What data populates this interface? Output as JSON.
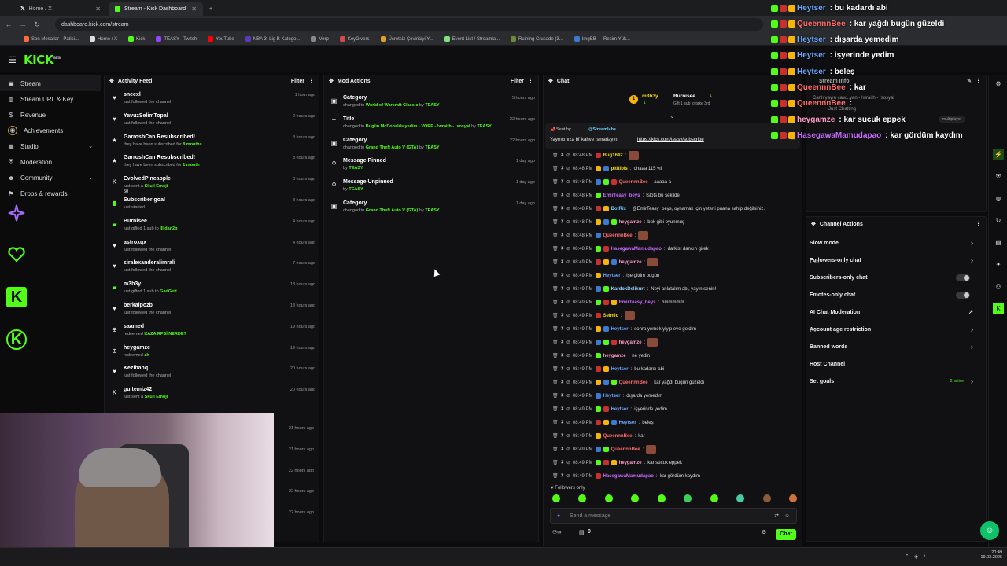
{
  "browser": {
    "tabs": [
      {
        "label": "Home / X"
      },
      {
        "label": "Stream - Kick Dashboard"
      }
    ],
    "new_tab": "+",
    "url": "dashboard.kick.com/stream",
    "bookmarks": [
      "Son Mesajlar - Patici...",
      "Home / X",
      "Kick",
      "TEASY - Twitch",
      "YouTube",
      "NBA 3. Lig B Katego...",
      "Vorp",
      "KeyGivers",
      "Ücretsiz Çeviriciyi Y...",
      "Event List / Streamla...",
      "Ruining Crusade (3...",
      "ImgBB — Resim Yük..."
    ],
    "all_bookmarks": "Tüm Yer İşaretleri"
  },
  "brand": {
    "logo": "KICK",
    "beta": "BETA",
    "accent": "#53fc18"
  },
  "sidebar": {
    "items": [
      {
        "label": "Stream",
        "icon": "video-icon"
      },
      {
        "label": "Stream URL & Key",
        "icon": "globe-icon"
      },
      {
        "label": "Revenue",
        "icon": "dollar-icon"
      },
      {
        "label": "Achievements",
        "icon": "trophy-icon"
      },
      {
        "label": "Studio",
        "icon": "grid-icon"
      },
      {
        "label": "Moderation",
        "icon": "shield-icon"
      },
      {
        "label": "Community",
        "icon": "people-icon"
      },
      {
        "label": "Drops & rewards",
        "icon": "gift-icon"
      }
    ]
  },
  "activity_feed": {
    "title": "Activity Feed",
    "filter": "Filter",
    "items": [
      {
        "name": "sneexl",
        "sub": "just followed the channel",
        "time": "1 hour ago",
        "icon": "heart-icon"
      },
      {
        "name": "YavuzSelimTopal",
        "sub": "just followed the channel",
        "time": "2 hours ago",
        "icon": "heart-icon"
      },
      {
        "name": "GarroshCan Resubscribed!",
        "sub_pre": "they have been subscribed for",
        "sub_hl": "8 months",
        "time": "3 hours ago",
        "icon": "star-icon"
      },
      {
        "name": "GarroshCan Resubscribed!",
        "sub_pre": "they have been subscribed for",
        "sub_hl": "1 month",
        "time": "3 hours ago",
        "icon": "star-icon"
      },
      {
        "name": "EvolvedPineapple",
        "sub_pre": "just sent a",
        "sub_hl": "Skull Emoji",
        "extra": "50",
        "time": "3 hours ago",
        "icon": "kick-icon"
      },
      {
        "name": "Subscriber goal",
        "sub": "just started",
        "time": "3 hours ago",
        "icon": "goal-icon"
      },
      {
        "name": "Burnisee",
        "sub_pre": "just gifted 1 sub to",
        "sub_hl": "Illidan2g",
        "time": "4 hours ago",
        "icon": "gift-icon"
      },
      {
        "name": "astroxqx",
        "sub": "just followed the channel",
        "time": "4 hours ago",
        "icon": "heart-icon"
      },
      {
        "name": "siralexanderalimrali",
        "sub": "just followed the channel",
        "time": "7 hours ago",
        "icon": "heart-icon"
      },
      {
        "name": "m3b3y",
        "sub_pre": "just gifted 1 sub to",
        "sub_hl": "GadGett",
        "time": "18 hours ago",
        "icon": "gift-icon"
      },
      {
        "name": "berkalpozb",
        "sub": "just followed the channel",
        "time": "18 hours ago",
        "icon": "heart-icon"
      },
      {
        "name": "saamed",
        "sub_pre": "redeemed",
        "sub_hl": "KAZA RPSİ NERDE?",
        "time": "19 hours ago",
        "icon": "redeem-icon"
      },
      {
        "name": "heygamze",
        "sub_pre": "redeemed",
        "sub_hl": "ah",
        "time": "19 hours ago",
        "icon": "redeem-icon"
      },
      {
        "name": "Kezibanq",
        "sub": "just followed the channel",
        "time": "20 hours ago",
        "icon": "heart-icon"
      },
      {
        "name": "guitemiz42",
        "sub_pre": "just sent a",
        "sub_hl": "Skull Emoji",
        "time": "20 hours ago",
        "icon": "kick-icon"
      }
    ],
    "hidden_times": [
      "21 hours ago",
      "21 hours ago",
      "22 hours ago",
      "22 hours ago",
      "22 hours ago"
    ]
  },
  "mod_actions": {
    "title": "Mod Actions",
    "filter": "Filter",
    "items": [
      {
        "name": "Category",
        "pre": "changed to",
        "hl": "World of Warcraft Classic",
        "by": "by",
        "user": "TEASY",
        "time": "5 hours ago",
        "icon": "category-icon"
      },
      {
        "name": "Title",
        "pre": "changed to",
        "hl": "Bugün McDonalds yedim - VORP - !wraith - !sosyal",
        "by": "by",
        "user": "TEASY",
        "time": "22 hours ago",
        "icon": "title-icon"
      },
      {
        "name": "Category",
        "pre": "changed to",
        "hl": "Grand Theft Auto V (GTA)",
        "by": "by",
        "user": "TEASY",
        "time": "22 hours ago",
        "icon": "category-icon"
      },
      {
        "name": "Message Pinned",
        "pre": "by",
        "hl": "",
        "by": "",
        "user": "TEASY",
        "time": "1 day ago",
        "icon": "pin-icon"
      },
      {
        "name": "Message Unpinned",
        "pre": "by",
        "hl": "",
        "by": "",
        "user": "TEASY",
        "time": "1 day ago",
        "icon": "unpin-icon"
      },
      {
        "name": "Category",
        "pre": "changed to",
        "hl": "Grand Theft Auto V (GTA)",
        "by": "by",
        "user": "TEASY",
        "time": "1 day ago",
        "icon": "category-icon"
      }
    ]
  },
  "chat": {
    "title": "Chat",
    "gift_banner": {
      "user": "m3b3y",
      "count": "1",
      "gifter": "Burnisee",
      "gifter_count": "1",
      "text": "Gift 1 sub to take 3rd"
    },
    "pinned": {
      "sent_by": "Sent by",
      "sender": "@Streamlabs",
      "text": "Yayıncınıza bi' kahve ısmarlayın;",
      "link": "https://kick.com/teasy/subscribe"
    },
    "messages": [
      {
        "time": "08:48 PM",
        "user": "Bug1642",
        "text": "",
        "color": "#f5d90a",
        "emote": true
      },
      {
        "time": "08:48 PM",
        "user": "pititibis",
        "text": "ohaaa 115 yıl",
        "color": "#f5d90a"
      },
      {
        "time": "08:48 PM",
        "user": "QueennnBee",
        "text": "aaaaa a",
        "color": "#ff6b6b"
      },
      {
        "time": "08:48 PM",
        "user": "EmirTeasy_beys",
        "text": "!slots bu şekilde",
        "color": "#c86bff"
      },
      {
        "time": "08:48 PM",
        "user": "BotRix",
        "text": "@EmirTeasy_beys, oynamak için yeterli puana sahip değilsiniz.",
        "color": "#6bd1ff"
      },
      {
        "time": "08:48 PM",
        "user": "heygamze",
        "text": "bok gibi oyunmuş",
        "color": "#ff9ac8"
      },
      {
        "time": "08:48 PM",
        "user": "QueennnBee",
        "text": "",
        "color": "#ff6b6b",
        "emote": true
      },
      {
        "time": "08:48 PM",
        "user": "HasegawaMamudapao",
        "text": "darkist dancın girek",
        "color": "#c86bff"
      },
      {
        "time": "08:49 PM",
        "user": "heygamze",
        "text": "",
        "color": "#ff9ac8",
        "emote": true
      },
      {
        "time": "08:49 PM",
        "user": "Heytser",
        "text": "işe gittim bugün",
        "color": "#6ba8ff"
      },
      {
        "time": "08:49 PM",
        "user": "KardokDelikurt",
        "text": "Neyi anlatalım abi, yayın senin!",
        "color": "#9ad0ff"
      },
      {
        "time": "08:49 PM",
        "user": "EmirTeasy_beys",
        "text": "hmmmmm",
        "color": "#c86bff"
      },
      {
        "time": "08:49 PM",
        "user": "Seimic",
        "text": "",
        "color": "#f5d90a",
        "emote": true
      },
      {
        "time": "08:49 PM",
        "user": "Heytser",
        "text": "sonra yemek yiyip eve geldim",
        "color": "#6ba8ff"
      },
      {
        "time": "08:49 PM",
        "user": "heygamze",
        "text": "",
        "color": "#ff9ac8",
        "emote": true
      },
      {
        "time": "08:49 PM",
        "user": "heygamze",
        "text": "ne yedin",
        "color": "#ff9ac8"
      },
      {
        "time": "08:49 PM",
        "user": "Heytser",
        "text": "bu kadardı abi",
        "color": "#6ba8ff"
      },
      {
        "time": "08:49 PM",
        "user": "QueennnBee",
        "text": "kar yağdı bugün güzeldi",
        "color": "#ff6b6b"
      },
      {
        "time": "08:49 PM",
        "user": "Heytser",
        "text": "dışarda yemedim",
        "color": "#6ba8ff"
      },
      {
        "time": "08:49 PM",
        "user": "Heytser",
        "text": "işyerinde yedim",
        "color": "#6ba8ff"
      },
      {
        "time": "08:49 PM",
        "user": "Heytser",
        "text": "beleş",
        "color": "#6ba8ff"
      },
      {
        "time": "08:49 PM",
        "user": "QueennnBee",
        "text": "kar",
        "color": "#ff6b6b"
      },
      {
        "time": "08:49 PM",
        "user": "QueennnBee",
        "text": "",
        "color": "#ff6b6b",
        "emote": true
      },
      {
        "time": "08:49 PM",
        "user": "heygamze",
        "text": "kar sucuk eppek",
        "color": "#ff9ac8"
      },
      {
        "time": "08:49 PM",
        "user": "HasegawaMamudapao",
        "text": "kar gördüm kaydım",
        "color": "#c86bff"
      }
    ],
    "followers_only": "Followers only",
    "send_placeholder": "Send a message",
    "points": "0",
    "chat_button": "Chat"
  },
  "stream_info": {
    "title": "Stream Info",
    "line1": "Canlı yayın caw...yan - !wraith - !sosyal",
    "line2": "Just Chatting",
    "tag": "multiplayer"
  },
  "channel_actions": {
    "title": "Channel Actions",
    "items": [
      {
        "label": "Slow mode",
        "control": "chevron"
      },
      {
        "label": "Followers-only chat",
        "sub": "1 min",
        "control": "chevron"
      },
      {
        "label": "Subscribers-only chat",
        "control": "toggle"
      },
      {
        "label": "Emotes-only chat",
        "control": "toggle"
      },
      {
        "label": "AI Chat Moderation",
        "control": "external"
      },
      {
        "label": "Account age restriction",
        "sub": "1 hr",
        "control": "chevron"
      },
      {
        "label": "Banned words",
        "control": "chevron"
      },
      {
        "label": "Host Channel",
        "control": "none"
      },
      {
        "label": "Set goals",
        "extra": "2 active",
        "control": "chevron"
      }
    ]
  },
  "overlay_chat": [
    {
      "user": "Heytser",
      "text": ": bu kadardı abi",
      "color": "#6ba8ff"
    },
    {
      "user": "QueennnBee",
      "text": ": kar yağdı bugün güzeldi",
      "color": "#ff6b6b"
    },
    {
      "user": "Heytser",
      "text": ": dışarda yemedim",
      "color": "#6ba8ff"
    },
    {
      "user": "Heytser",
      "text": ": işyerinde yedim",
      "color": "#6ba8ff"
    },
    {
      "user": "Heytser",
      "text": ": beleş",
      "color": "#6ba8ff"
    },
    {
      "user": "QueennnBee",
      "text": ": kar",
      "color": "#ff6b6b"
    },
    {
      "user": "QueennnBee",
      "text": ":",
      "color": "#ff6b6b"
    },
    {
      "user": "heygamze",
      "text": ": kar sucuk eppek",
      "color": "#ff9ac8"
    },
    {
      "user": "HasegawaMamudapao",
      "text": ": kar gördüm kaydım",
      "color": "#c86bff"
    }
  ],
  "taskbar": {
    "time": "20:49",
    "date": "19.03.2026"
  }
}
